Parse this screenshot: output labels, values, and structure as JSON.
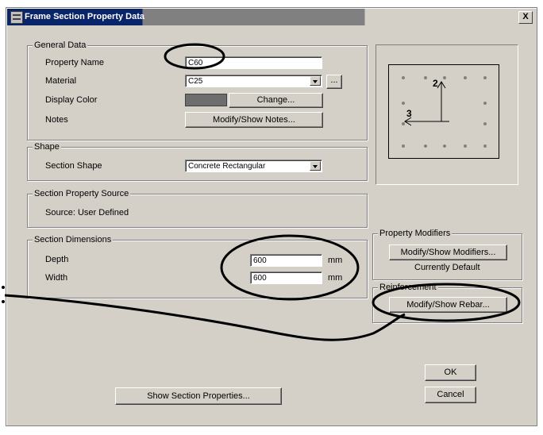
{
  "window": {
    "title": "Frame Section Property Data",
    "close_label": "X"
  },
  "general": {
    "legend": "General Data",
    "property_name_label": "Property Name",
    "property_name_value": "C60",
    "material_label": "Material",
    "material_value": "C25",
    "material_more": "...",
    "display_color_label": "Display Color",
    "display_color_swatch": "#6d6d6d",
    "change_label": "Change...",
    "notes_label": "Notes",
    "notes_button": "Modify/Show Notes..."
  },
  "shape": {
    "legend": "Shape",
    "section_shape_label": "Section Shape",
    "section_shape_value": "Concrete Rectangular"
  },
  "source": {
    "legend": "Section Property Source",
    "source_text": "Source:  User Defined"
  },
  "dimensions": {
    "legend": "Section Dimensions",
    "depth_label": "Depth",
    "depth_value": "600",
    "depth_unit": "mm",
    "width_label": "Width",
    "width_value": "600",
    "width_unit": "mm"
  },
  "preview": {
    "axis_2": "2",
    "axis_3": "3"
  },
  "modifiers": {
    "legend": "Property Modifiers",
    "button": "Modify/Show Modifiers...",
    "status": "Currently Default"
  },
  "reinforcement": {
    "legend": "Reinforcement",
    "button": "Modify/Show Rebar..."
  },
  "actions": {
    "show_properties": "Show Section Properties...",
    "ok": "OK",
    "cancel": "Cancel"
  }
}
